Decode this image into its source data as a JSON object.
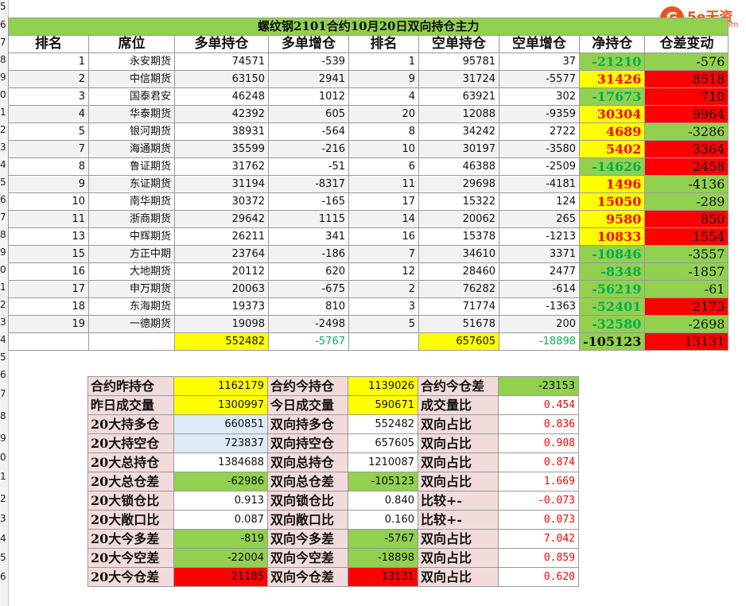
{
  "title": "螺纹钢2101合约10月20日双向持仓主力",
  "row_numbers": [
    "5",
    "6",
    "7",
    "8",
    "9",
    "0",
    "1",
    "2",
    "3",
    "4",
    "5",
    "6",
    "7",
    "8",
    "9",
    "0",
    "1",
    "2",
    "3",
    "4",
    "5",
    "6",
    "7",
    "8",
    "9",
    "0",
    "1",
    "2",
    "3",
    "4",
    "5",
    "6"
  ],
  "logo": {
    "mark": "G",
    "brand": "5e天资",
    "site": "5etz.com"
  },
  "headers": [
    "排名",
    "席位",
    "多单持仓",
    "多单增仓",
    "排名",
    "空单持仓",
    "空单增仓",
    "净持仓",
    "仓差变动"
  ],
  "rows": [
    {
      "rank": "1",
      "seat": "永安期货",
      "long": "74571",
      "long_chg": "-539",
      "srank": "1",
      "short": "95781",
      "short_chg": "37",
      "net": "-21210",
      "diff": "-576"
    },
    {
      "rank": "2",
      "seat": "中信期货",
      "long": "63150",
      "long_chg": "2941",
      "srank": "9",
      "short": "31724",
      "short_chg": "-5577",
      "net": "31426",
      "diff": "8518"
    },
    {
      "rank": "3",
      "seat": "国泰君安",
      "long": "46248",
      "long_chg": "1012",
      "srank": "4",
      "short": "63921",
      "short_chg": "302",
      "net": "-17673",
      "diff": "710"
    },
    {
      "rank": "4",
      "seat": "华泰期货",
      "long": "42392",
      "long_chg": "605",
      "srank": "20",
      "short": "12088",
      "short_chg": "-9359",
      "net": "30304",
      "diff": "9964"
    },
    {
      "rank": "5",
      "seat": "银河期货",
      "long": "38931",
      "long_chg": "-564",
      "srank": "8",
      "short": "34242",
      "short_chg": "2722",
      "net": "4689",
      "diff": "-3286"
    },
    {
      "rank": "7",
      "seat": "海通期货",
      "long": "35599",
      "long_chg": "-216",
      "srank": "10",
      "short": "30197",
      "short_chg": "-3580",
      "net": "5402",
      "diff": "3364"
    },
    {
      "rank": "8",
      "seat": "鲁证期货",
      "long": "31762",
      "long_chg": "-51",
      "srank": "6",
      "short": "46388",
      "short_chg": "-2509",
      "net": "-14626",
      "diff": "2458"
    },
    {
      "rank": "9",
      "seat": "东证期货",
      "long": "31194",
      "long_chg": "-8317",
      "srank": "11",
      "short": "29698",
      "short_chg": "-4181",
      "net": "1496",
      "diff": "-4136"
    },
    {
      "rank": "10",
      "seat": "南华期货",
      "long": "30372",
      "long_chg": "-165",
      "srank": "17",
      "short": "15322",
      "short_chg": "124",
      "net": "15050",
      "diff": "-289"
    },
    {
      "rank": "11",
      "seat": "浙商期货",
      "long": "29642",
      "long_chg": "1115",
      "srank": "14",
      "short": "20062",
      "short_chg": "265",
      "net": "9580",
      "diff": "850"
    },
    {
      "rank": "13",
      "seat": "中辉期货",
      "long": "26211",
      "long_chg": "341",
      "srank": "16",
      "short": "15378",
      "short_chg": "-1213",
      "net": "10833",
      "diff": "1554"
    },
    {
      "rank": "15",
      "seat": "方正中期",
      "long": "23764",
      "long_chg": "-186",
      "srank": "7",
      "short": "34610",
      "short_chg": "3371",
      "net": "-10846",
      "diff": "-3557"
    },
    {
      "rank": "16",
      "seat": "大地期货",
      "long": "20112",
      "long_chg": "620",
      "srank": "12",
      "short": "28460",
      "short_chg": "2477",
      "net": "-8348",
      "diff": "-1857"
    },
    {
      "rank": "17",
      "seat": "申万期货",
      "long": "20063",
      "long_chg": "-675",
      "srank": "2",
      "short": "76282",
      "short_chg": "-614",
      "net": "-56219",
      "diff": "-61"
    },
    {
      "rank": "18",
      "seat": "东海期货",
      "long": "19373",
      "long_chg": "810",
      "srank": "3",
      "short": "71774",
      "short_chg": "-1363",
      "net": "-52401",
      "diff": "2173"
    },
    {
      "rank": "19",
      "seat": "一德期货",
      "long": "19098",
      "long_chg": "-2498",
      "srank": "5",
      "short": "51678",
      "short_chg": "200",
      "net": "-32580",
      "diff": "-2698"
    }
  ],
  "totals": {
    "long": "552482",
    "long_chg": "-5767",
    "short": "657605",
    "short_chg": "-18898",
    "net": "-105123",
    "diff": "13131"
  },
  "stats": [
    {
      "l1": "合约昨持仓",
      "v1": "1162179",
      "l2": "合约今持仓",
      "v2": "1139026",
      "l3": "合约今仓差",
      "v3": "-23153"
    },
    {
      "l1": "昨日成交量",
      "v1": "1300997",
      "l2": "今日成交量",
      "v2": "590671",
      "l3": "成交量比",
      "v3": "0.454"
    },
    {
      "l1": "20大持多仓",
      "v1": "660851",
      "l2": "双向持多仓",
      "v2": "552482",
      "l3": "双向占比",
      "v3": "0.836"
    },
    {
      "l1": "20大持空仓",
      "v1": "723837",
      "l2": "双向持空仓",
      "v2": "657605",
      "l3": "双向占比",
      "v3": "0.908"
    },
    {
      "l1": "20大总持仓",
      "v1": "1384688",
      "l2": "双向总持仓",
      "v2": "1210087",
      "l3": "双向占比",
      "v3": "0.874"
    },
    {
      "l1": "20大总仓差",
      "v1": "-62986",
      "l2": "双向总仓差",
      "v2": "-105123",
      "l3": "双向占比",
      "v3": "1.669"
    },
    {
      "l1": "20大锁仓比",
      "v1": "0.913",
      "l2": "双向锁仓比",
      "v2": "0.840",
      "l3": "比较+-",
      "v3": "-0.073"
    },
    {
      "l1": "20大敞口比",
      "v1": "0.087",
      "l2": "双向敞口比",
      "v2": "0.160",
      "l3": "比较+-",
      "v3": "0.073"
    },
    {
      "l1": "20大今多差",
      "v1": "-819",
      "l2": "双向今多差",
      "v2": "-5767",
      "l3": "双向占比",
      "v3": "7.042"
    },
    {
      "l1": "20大今空差",
      "v1": "-22004",
      "l2": "双向今空差",
      "v2": "-18898",
      "l3": "双向占比",
      "v3": "0.859"
    },
    {
      "l1": "20大今仓差",
      "v1": "21185",
      "l2": "双向今仓差",
      "v2": "13131",
      "l3": "双向占比",
      "v3": "0.620"
    }
  ]
}
